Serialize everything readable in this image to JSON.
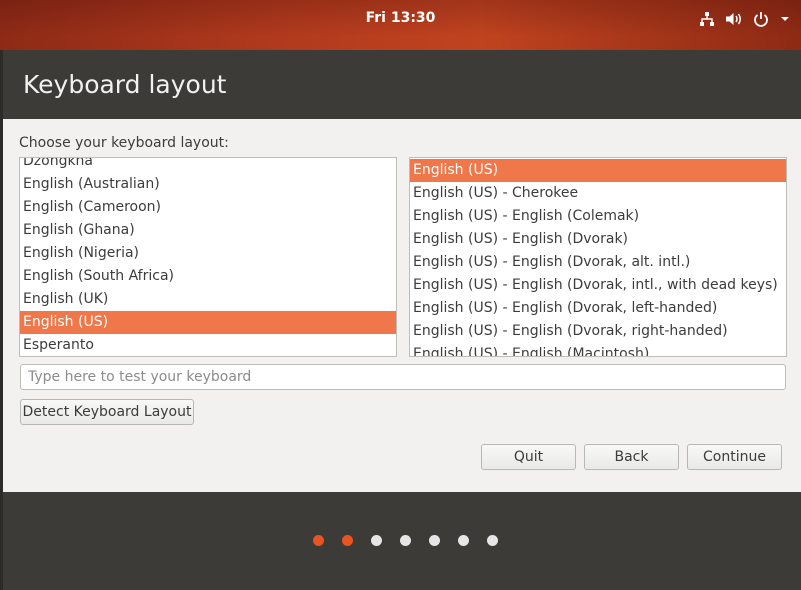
{
  "topbar": {
    "clock": "Fri 13:30",
    "icons": [
      "network-icon",
      "volume-icon",
      "power-icon",
      "chevron-down-icon"
    ]
  },
  "window": {
    "title": "Keyboard layout"
  },
  "prompt": "Choose your keyboard layout:",
  "layouts": {
    "items": [
      "Dzongkha",
      "English (Australian)",
      "English (Cameroon)",
      "English (Ghana)",
      "English (Nigeria)",
      "English (South Africa)",
      "English (UK)",
      "English (US)",
      "Esperanto"
    ],
    "selected": "English (US)"
  },
  "variants": {
    "items": [
      "English (US)",
      "English (US) - Cherokee",
      "English (US) - English (Colemak)",
      "English (US) - English (Dvorak)",
      "English (US) - English (Dvorak, alt. intl.)",
      "English (US) - English (Dvorak, intl., with dead keys)",
      "English (US) - English (Dvorak, left-handed)",
      "English (US) - English (Dvorak, right-handed)",
      "English (US) - English (Macintosh)"
    ],
    "selected": "English (US)"
  },
  "test_input": {
    "placeholder": "Type here to test your keyboard",
    "value": ""
  },
  "buttons": {
    "detect": "Detect Keyboard Layout",
    "quit": "Quit",
    "back": "Back",
    "continue": "Continue"
  },
  "progress": {
    "total_steps": 7,
    "completed_steps": 2
  },
  "colors": {
    "accent": "#e95420",
    "selection": "#ef7749",
    "panel_dark": "#3c3b37"
  }
}
